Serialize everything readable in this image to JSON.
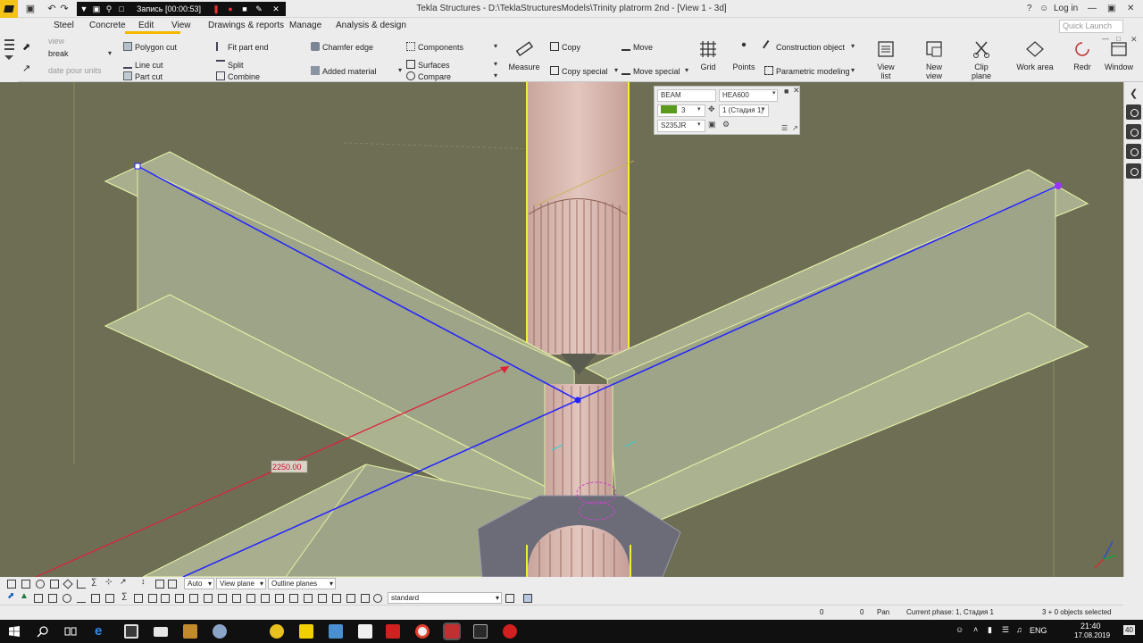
{
  "titlebar": {
    "recording": "Запись [00:00:53]",
    "window_title": "Tekla Structures - D:\\TeklaStructuresModels\\Trinity platrorm 2nd - [View 1 - 3d]",
    "help": "?",
    "login": "Log in"
  },
  "menu": [
    "Steel",
    "Concrete",
    "Edit",
    "View",
    "Drawings & reports",
    "Manage",
    "Analysis & design"
  ],
  "quick_launch_placeholder": "Quick Launch",
  "ribbon": {
    "faint_view": "view",
    "break": "break",
    "faint_units": "date pour units",
    "polygon_cut": "Polygon cut",
    "line_cut": "Line cut",
    "part_cut": "Part cut",
    "fit_part_end": "Fit part end",
    "split": "Split",
    "combine": "Combine",
    "chamfer_edge": "Chamfer edge",
    "added_material": "Added material",
    "components": "Components",
    "surfaces": "Surfaces",
    "compare": "Compare",
    "measure": "Measure",
    "copy": "Copy",
    "copy_special": "Copy special",
    "move": "Move",
    "move_special": "Move special",
    "grid": "Grid",
    "points": "Points",
    "construction_object": "Construction object",
    "parametric_modeling": "Parametric modeling",
    "view_list": "View list",
    "new_view": "New view",
    "clip_plane": "Clip plane",
    "work_area": "Work area",
    "redraw": "Redr",
    "window": "Window"
  },
  "property_panel": {
    "type": "BEAM",
    "profile": "HEA600",
    "class": "3",
    "phase": "1 (Стадия 1)",
    "material": "S235JR",
    "class_color": "#5b9a1e"
  },
  "viewport": {
    "dimension": "2250.00"
  },
  "bottom_toolbar": {
    "auto": "Auto",
    "view_plane": "View plane",
    "outline_planes": "Outline planes",
    "standard": "standard"
  },
  "status": {
    "x": "0",
    "y": "0",
    "mode": "Pan",
    "phase": "Current phase: 1, Стадия 1",
    "selection": "3 + 0 objects selected"
  },
  "taskbar": {
    "lang": "ENG",
    "time": "21:40",
    "date": "17.08.2019",
    "notifications": "40"
  },
  "colors": {
    "viewport_bg": "#6e6e55",
    "beam_fill": "#a8ae8e",
    "beam_edge": "#e4eea4",
    "column": "#d6b6ae",
    "plate": "#6c6c78",
    "axis_blue": "#2222ff",
    "dim_red": "#e0203a"
  }
}
